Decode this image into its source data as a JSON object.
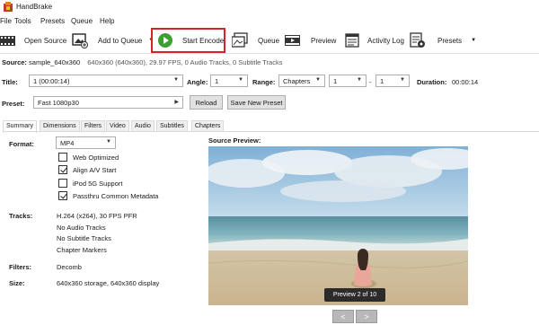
{
  "window": {
    "title": "HandBrake"
  },
  "menu": [
    "File",
    "Tools",
    "Presets",
    "Queue",
    "Help"
  ],
  "toolbar": {
    "open_source": "Open Source",
    "add_to_queue": "Add to Queue",
    "start_encode": "Start Encode",
    "queue": "Queue",
    "preview": "Preview",
    "activity_log": "Activity Log",
    "presets": "Presets"
  },
  "source": {
    "label": "Source:",
    "name": "sample_640x360",
    "info": "640x360 (640x360), 29.97 FPS, 0 Audio Tracks, 0 Subtitle Tracks"
  },
  "title_row": {
    "title_label": "Title:",
    "title_value": "1 (00:00:14)",
    "angle_label": "Angle:",
    "angle_value": "1",
    "range_label": "Range:",
    "range_mode": "Chapters",
    "range_start": "1",
    "range_sep": "-",
    "range_end": "1",
    "duration_label": "Duration:",
    "duration_value": "00:00:14"
  },
  "preset_row": {
    "label": "Preset:",
    "value": "Fast 1080p30",
    "reload": "Reload",
    "save_new": "Save New Preset"
  },
  "tabs": [
    "Summary",
    "Dimensions",
    "Filters",
    "Video",
    "Audio",
    "Subtitles",
    "Chapters"
  ],
  "summary": {
    "format_label": "Format:",
    "format_value": "MP4",
    "options": [
      {
        "label": "Web Optimized",
        "checked": false
      },
      {
        "label": "Align A/V Start",
        "checked": true
      },
      {
        "label": "iPod 5G Support",
        "checked": false
      },
      {
        "label": "Passthru Common Metadata",
        "checked": true
      }
    ],
    "tracks_label": "Tracks:",
    "tracks": [
      "H.264 (x264), 30 FPS PFR",
      "No Audio Tracks",
      "No Subtitle Tracks",
      "Chapter Markers"
    ],
    "filters_label": "Filters:",
    "filters_value": "Decomb",
    "size_label": "Size:",
    "size_value": "640x360 storage, 640x360 display"
  },
  "preview": {
    "label": "Source Preview:",
    "badge": "Preview 2 of 10",
    "prev": "<",
    "next": ">"
  },
  "colors": {
    "highlight": "#d6232b",
    "play_green": "#3aa02e"
  }
}
